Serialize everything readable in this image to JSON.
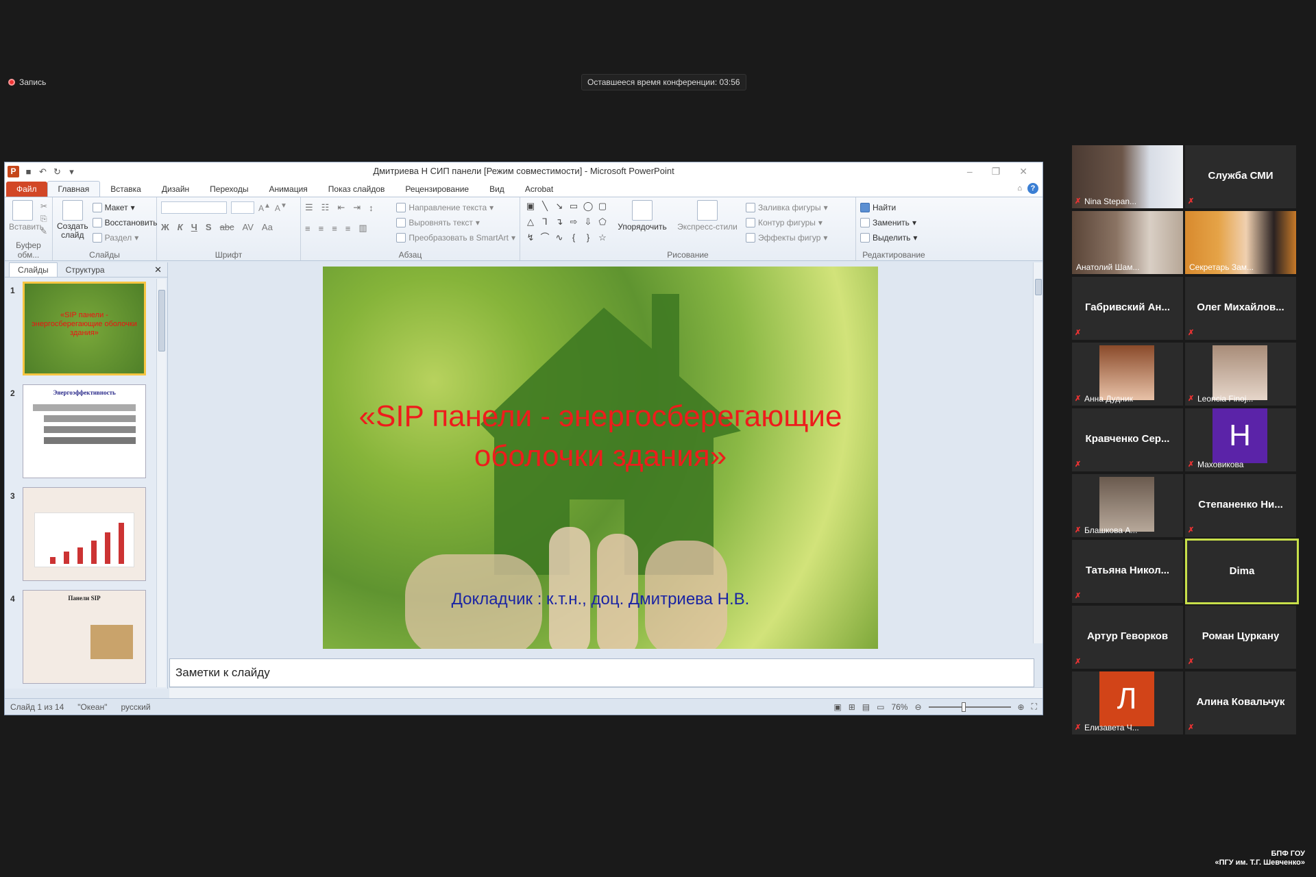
{
  "top": {
    "record_label": "Запись",
    "timer_text": "Оставшееся время конференции: 03:56"
  },
  "pp": {
    "window_title": "Дмитриева Н СИП панели [Режим совместимости]  -  Microsoft PowerPoint",
    "tabs": [
      "Файл",
      "Главная",
      "Вставка",
      "Дизайн",
      "Переходы",
      "Анимация",
      "Показ слайдов",
      "Рецензирование",
      "Вид",
      "Acrobat"
    ],
    "ribbon": {
      "buffer": {
        "paste": "Вставить",
        "label": "Буфер обм..."
      },
      "slides": {
        "new_slide": "Создать слайд",
        "layout": "Макет",
        "reset": "Восстановить",
        "section": "Раздел",
        "label": "Слайды"
      },
      "font": {
        "label": "Шрифт",
        "bold": "Ж",
        "italic": "К",
        "underline": "Ч",
        "strike": "S",
        "shadow": "abc",
        "spacing": "AV",
        "case": "Aa"
      },
      "paragraph": {
        "text_dir": "Направление текста",
        "align_text": "Выровнять текст",
        "smartart": "Преобразовать в SmartArt",
        "label": "Абзац"
      },
      "drawing": {
        "arrange": "Упорядочить",
        "quick_styles": "Экспресс-стили",
        "fill": "Заливка фигуры",
        "outline": "Контур фигуры",
        "effects": "Эффекты фигур",
        "label": "Рисование"
      },
      "editing": {
        "find": "Найти",
        "replace": "Заменить",
        "select": "Выделить",
        "label": "Редактирование"
      }
    },
    "left_tabs": [
      "Слайды",
      "Структура"
    ],
    "thumbs": [
      {
        "num": "1",
        "title": "«SIP панели - энергосберегающие оболочки здания»"
      },
      {
        "num": "2",
        "title": "Энергоэффективность"
      },
      {
        "num": "3",
        "title": ""
      },
      {
        "num": "4",
        "title": "Панели SIP"
      }
    ],
    "slide": {
      "title": "«SIP панели - энергосберегающие оболочки здания»",
      "reporter": "Докладчик : к.т.н., доц. Дмитриева Н.В."
    },
    "notes_placeholder": "Заметки к слайду",
    "status": {
      "slide_count": "Слайд 1 из 14",
      "theme": "\"Океан\"",
      "lang": "русский",
      "zoom": "76%"
    }
  },
  "participants": [
    {
      "name": "Nina Stepan...",
      "type": "video"
    },
    {
      "name": "Служба СМИ",
      "type": "name"
    },
    {
      "name": "Анатолий Шам...",
      "type": "video"
    },
    {
      "name": "Секретарь Зам...",
      "type": "video"
    },
    {
      "name": "Габривский  Ан...",
      "type": "name"
    },
    {
      "name": "Олег  Михайлов...",
      "type": "name"
    },
    {
      "name": "Анна Дудник",
      "type": "photo"
    },
    {
      "name": "Leoncia Finoj...",
      "type": "photo"
    },
    {
      "name": "Кравченко  Сер...",
      "type": "name"
    },
    {
      "name": "Маховикова",
      "type": "letter",
      "letter": "Н",
      "color": "#5b23a8"
    },
    {
      "name": "Блашкова А...",
      "type": "photo"
    },
    {
      "name": "Степаненко  Ни...",
      "type": "name"
    },
    {
      "name": "Татьяна  Никол...",
      "type": "name"
    },
    {
      "name": "Dima",
      "type": "name",
      "active": true
    },
    {
      "name": "Артур Геворков",
      "type": "name"
    },
    {
      "name": "Роман Цуркану",
      "type": "name"
    },
    {
      "name": "Елизавета Ч...",
      "type": "letter",
      "letter": "Л",
      "color": "#d24418"
    },
    {
      "name": "Алина Ковальчук",
      "type": "name"
    }
  ],
  "footer": {
    "line1": "БПФ ГОУ",
    "line2": "«ПГУ им. Т.Г. Шевченко»"
  },
  "colors": {
    "accent_active": "#c8e04a",
    "slide_title": "#ee1c1c",
    "slide_reporter": "#1a24a3",
    "file_tab": "#d24726"
  }
}
